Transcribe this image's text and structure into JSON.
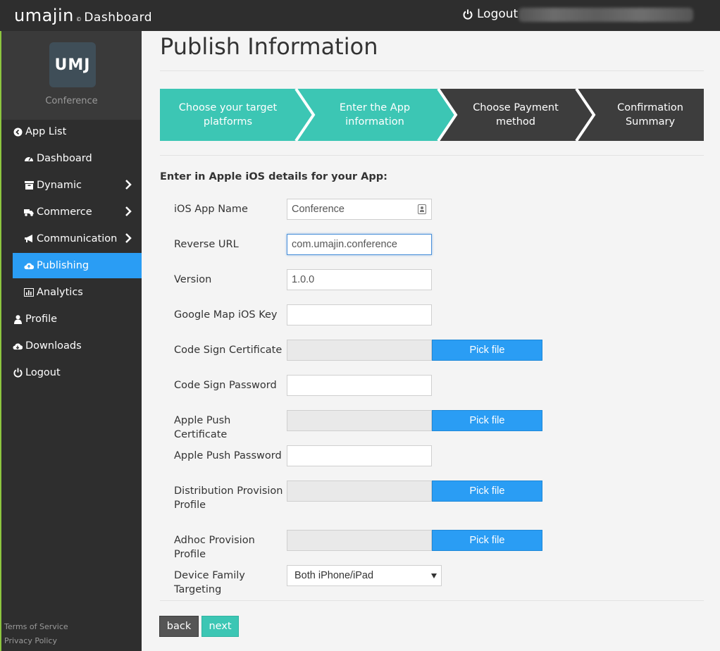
{
  "header": {
    "brand": "umajin",
    "trademark": "©",
    "subtitle": "Dashboard",
    "logout_label": "Logout"
  },
  "sidebar": {
    "app_tile": "UMJ",
    "app_name": "Conference",
    "items": [
      {
        "label": "App List",
        "icon": "arrow-circle-left-icon"
      },
      {
        "label": "Dashboard",
        "icon": "dashboard-gauge-icon"
      },
      {
        "label": "Dynamic",
        "icon": "archive-box-icon"
      },
      {
        "label": "Commerce",
        "icon": "truck-icon"
      },
      {
        "label": "Communication",
        "icon": "bullhorn-icon"
      },
      {
        "label": "Publishing",
        "icon": "cloud-upload-icon"
      },
      {
        "label": "Analytics",
        "icon": "bar-chart-icon"
      },
      {
        "label": "Profile",
        "icon": "user-icon"
      },
      {
        "label": "Downloads",
        "icon": "cloud-download-icon"
      },
      {
        "label": "Logout",
        "icon": "power-icon"
      }
    ],
    "footer": {
      "terms": "Terms of Service",
      "privacy": "Privacy Policy"
    }
  },
  "main": {
    "title": "Publish Information",
    "steps": [
      {
        "line1": "Choose your target",
        "line2": "platforms",
        "state": "done"
      },
      {
        "line1": "Enter the App",
        "line2": "information",
        "state": "current"
      },
      {
        "line1": "Choose Payment",
        "line2": "method",
        "state": "todo"
      },
      {
        "line1": "Confirmation",
        "line2": "Summary",
        "state": "todo"
      }
    ],
    "section_title": "Enter in Apple iOS details for your App:",
    "form": {
      "app_name": {
        "label": "iOS App Name",
        "value": "Conference"
      },
      "reverse_url": {
        "label": "Reverse URL",
        "value": "com.umajin.conference"
      },
      "version": {
        "label": "Version",
        "value": "1.0.0"
      },
      "google_map_key": {
        "label": "Google Map iOS Key",
        "value": ""
      },
      "code_sign_cert": {
        "label": "Code Sign Certificate",
        "value": ""
      },
      "code_sign_password": {
        "label": "Code Sign Password",
        "value": ""
      },
      "apple_push_cert": {
        "label": "Apple Push Certificate",
        "value": ""
      },
      "apple_push_password": {
        "label": "Apple Push Password",
        "value": ""
      },
      "distribution_profile": {
        "label": "Distribution Provision Profile",
        "value": ""
      },
      "adhoc_profile": {
        "label": "Adhoc Provision Profile",
        "value": ""
      },
      "device_family": {
        "label": "Device Family Targeting",
        "value": "Both iPhone/iPad"
      }
    },
    "pick_file_label": "Pick file",
    "back_label": "back",
    "next_label": "next"
  },
  "colors": {
    "topbar": "#2e2e2e",
    "active_nav": "#2a9df4",
    "step_done": "#3cc6b4",
    "step_todo": "#3d3d3d",
    "button_primary": "#2a9df4",
    "button_next": "#3cc6b4",
    "button_back": "#555555"
  }
}
